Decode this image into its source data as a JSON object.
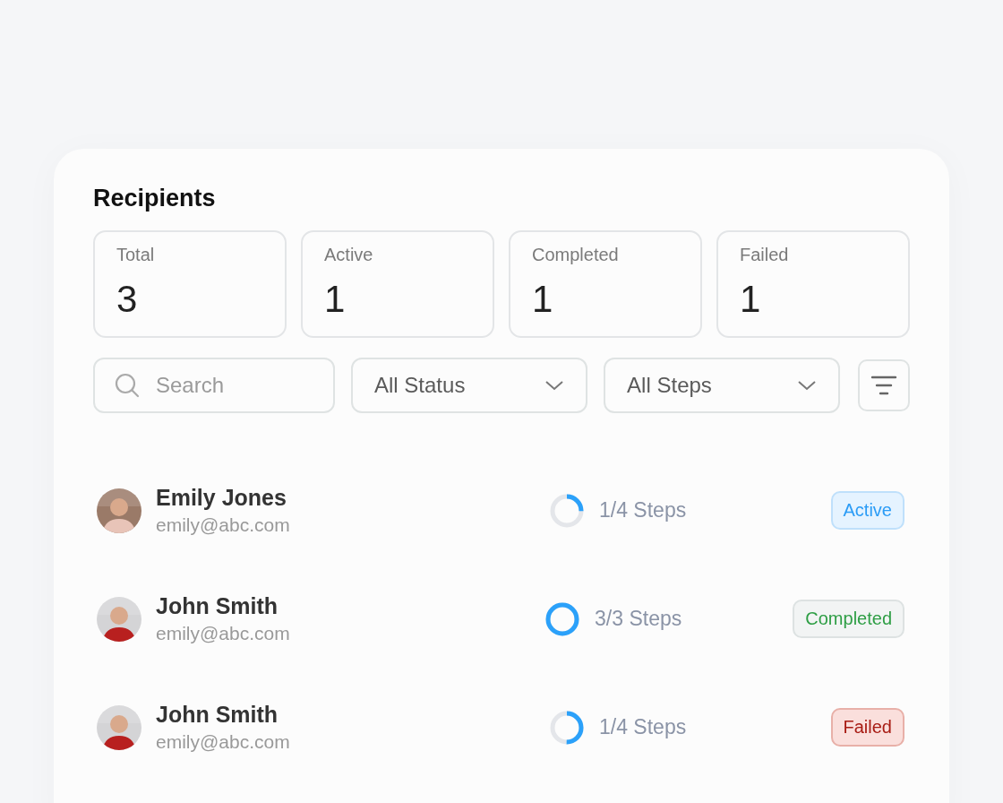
{
  "title": "Recipients",
  "stats": [
    {
      "label": "Total",
      "value": "3"
    },
    {
      "label": "Active",
      "value": "1"
    },
    {
      "label": "Completed",
      "value": "1"
    },
    {
      "label": "Failed",
      "value": "1"
    }
  ],
  "search": {
    "placeholder": "Search"
  },
  "filters": [
    {
      "value": "All Status"
    },
    {
      "value": "All Steps"
    }
  ],
  "recipients": [
    {
      "name": "Emily Jones",
      "email": "emily@abc.com",
      "steps": "1/4 Steps",
      "level": 0.25,
      "status": {
        "label": "Active",
        "kind": "active"
      }
    },
    {
      "name": "John Smith",
      "email": "emily@abc.com",
      "steps": "3/3 Steps",
      "level": 1,
      "status": {
        "label": "Completed",
        "kind": "completed"
      }
    },
    {
      "name": "John Smith",
      "email": "emily@abc.com",
      "steps": "1/4 Steps",
      "level": 0.5,
      "status": {
        "label": "Failed",
        "kind": "failed"
      }
    }
  ]
}
